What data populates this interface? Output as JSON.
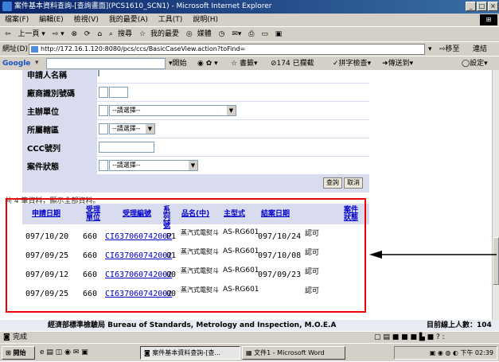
{
  "window": {
    "title": "案件基本資料查詢-[查詢畫面](PCS1610_SCN1) - Microsoft Internet Explorer"
  },
  "menu": [
    "檔案(F)",
    "編輯(E)",
    "檢視(V)",
    "我的最愛(A)",
    "工具(T)",
    "說明(H)"
  ],
  "toolbar": {
    "back": "上一頁",
    "search": "搜尋",
    "favorites": "我的最愛",
    "media": "媒體"
  },
  "address": {
    "label": "網址(D)",
    "url": "http://172.16.1.120:8080/pcs/ccs/BasicCaseView.action?toFind=",
    "go": "移至",
    "links": "連結"
  },
  "google": {
    "label": "Google",
    "search": "開始",
    "bookmarks": "書籤",
    "blocked": "174 已攔截",
    "spell": "拼字檢查",
    "send": "傳送到",
    "settings": "設定"
  },
  "form": {
    "rows": [
      {
        "label": "申請人名稱"
      },
      {
        "label": "廠商識別號碼"
      },
      {
        "label": "主辦單位",
        "select": "--請選擇--"
      },
      {
        "label": "所屬轄區",
        "select": "--請選擇--"
      },
      {
        "label": "CCC號列"
      },
      {
        "label": "案件狀態",
        "select": "--請選擇--"
      }
    ],
    "query_button": "查詢",
    "cancel_button": "取消"
  },
  "summary": "共 4 筆資料，顯示全部資料。",
  "table": {
    "headers": [
      "申請日期",
      "受理單位",
      "受理編號",
      "系列號",
      "品名(中)",
      "主型式",
      "結案日期",
      "案件狀態"
    ],
    "rows": [
      [
        "097/10/20",
        "660",
        "CI637060742002",
        "P1",
        "蒸汽式電熨斗",
        "AS-RG601",
        "097/10/24",
        "認可"
      ],
      [
        "097/09/25",
        "660",
        "CI637060742002",
        "01",
        "蒸汽式電熨斗",
        "AS-RG601",
        "097/10/08",
        "認可"
      ],
      [
        "097/09/12",
        "660",
        "CI637060742002",
        "00",
        "蒸汽式電熨斗",
        "AS-RG601",
        "097/09/23",
        "認可"
      ],
      [
        "097/09/25",
        "660",
        "CI637060742002",
        "00",
        "蒸汽式電熨斗",
        "AS-RG601",
        "",
        "認可"
      ]
    ]
  },
  "footer": {
    "agency": "經濟部標準檢驗局 Bureau of Standards, Metrology and Inspection, M.O.E.A",
    "online": "目前線上人數：104"
  },
  "status": {
    "text": "完成"
  },
  "taskbar": {
    "start": "開始",
    "task1": "案件基本資料查詢-[查...",
    "task2": "文件1 - Microsoft Word",
    "clock": "下午 02:39"
  },
  "colors": {
    "highlight_box": "#e00000",
    "form_bg": "#d9dbef",
    "link": "#0000cc"
  }
}
